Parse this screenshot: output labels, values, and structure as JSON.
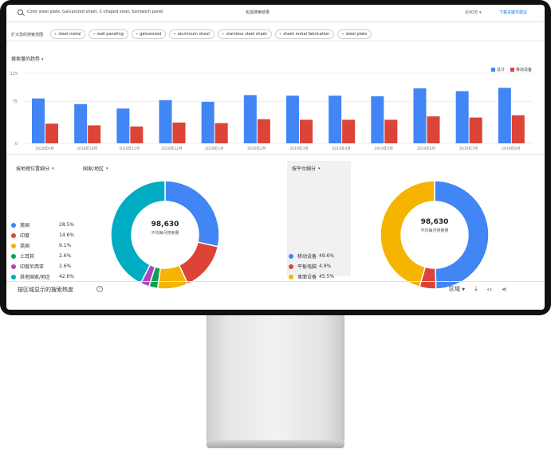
{
  "search": {
    "value": "Color steel plate, Galvanized sheet, C-shaped steel, Sandwich panel",
    "button": "包括搜索结果"
  },
  "header": {
    "history": "近90天 ▾",
    "download": "下载关键字建议"
  },
  "keyword_row": {
    "label": "扩大您的搜索范围",
    "chips": [
      "steel metal",
      "wall paneling",
      "galvanized",
      "aluminum sheet",
      "stainless steel sheet",
      "sheet metal fabrication",
      "steel plate"
    ]
  },
  "volume_section": {
    "title": "搜索量的趋势",
    "legend_total": "总计",
    "legend_mobile": "移动设备"
  },
  "chart_data": {
    "type": "bar",
    "categories": [
      "2018年9月",
      "2018年10月",
      "2018年11月",
      "2018年12月",
      "2019年1月",
      "2019年2月",
      "2019年3月",
      "2019年4月",
      "2019年5月",
      "2019年6月",
      "2019年7月",
      "2019年8月"
    ],
    "series": [
      {
        "name": "总计",
        "color": "#4285f4",
        "values": [
          80,
          70,
          62,
          77,
          74,
          86,
          85,
          85,
          84,
          98,
          93,
          99
        ]
      },
      {
        "name": "移动设备",
        "color": "#db4437",
        "values": [
          35,
          32,
          30,
          37,
          36,
          43,
          42,
          42,
          42,
          48,
          46,
          50
        ]
      }
    ],
    "y_ticks": [
      "125",
      "75",
      "0"
    ],
    "ylim": [
      0,
      125
    ]
  },
  "location_section": {
    "breakdown_label": "按地理位置细分",
    "region_label": "国家/地区",
    "total_value": "98,630",
    "total_caption": "平均每月搜索量",
    "items": [
      {
        "name": "美国",
        "value": "28.5%",
        "color": "#4285f4"
      },
      {
        "name": "印度",
        "value": "14.6%",
        "color": "#db4437"
      },
      {
        "name": "英国",
        "value": "9.1%",
        "color": "#f4b400"
      },
      {
        "name": "土耳其",
        "value": "2.6%",
        "color": "#0f9d58"
      },
      {
        "name": "印度尼西亚",
        "value": "2.6%",
        "color": "#ab47bc"
      },
      {
        "name": "其他国家/地区",
        "value": "42.6%",
        "color": "#00acc1"
      }
    ]
  },
  "platform_section": {
    "breakdown_label": "按平台细分",
    "total_value": "98,630",
    "total_caption": "平均每月搜索量",
    "items": [
      {
        "name": "移动设备",
        "value": "49.6%",
        "color": "#4285f4"
      },
      {
        "name": "平板电脑",
        "value": "4.9%",
        "color": "#db4437"
      },
      {
        "name": "桌面设备",
        "value": "45.5%",
        "color": "#f4b400"
      }
    ]
  },
  "footer": {
    "title": "按区域显示的搜索热度",
    "region_select": "区域"
  },
  "colors": {
    "accent": "#1a73e8",
    "blue": "#4285f4",
    "red": "#db4437",
    "yellow": "#f4b400"
  }
}
